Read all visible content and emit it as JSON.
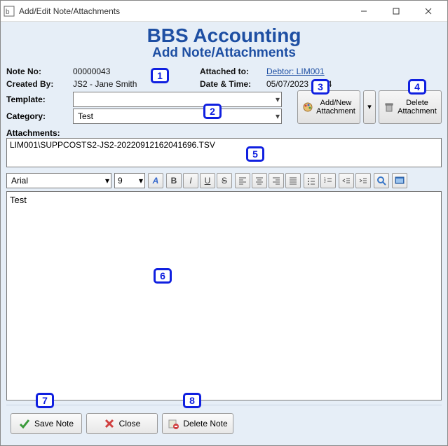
{
  "window": {
    "title": "Add/Edit Note/Attachments"
  },
  "heading": {
    "app": "BBS Accounting",
    "page": "Add Note/Attachments"
  },
  "info": {
    "note_no_label": "Note No:",
    "note_no": "00000043",
    "attached_to_label": "Attached to:",
    "attached_to": "Debtor: LIM001",
    "created_by_label": "Created By:",
    "created_by": "JS2 - Jane Smith",
    "datetime_label": "Date & Time:",
    "datetime": "05/07/2023 12:14"
  },
  "controls": {
    "template_label": "Template:",
    "template_value": "",
    "category_label": "Category:",
    "category_value": "Test",
    "attachments_label": "Attachments:",
    "attachments_value": "LIM001\\SUPPCOSTS2-JS2-20220912162041696.TSV",
    "add_attachment": "Add/New\nAttachment",
    "delete_attachment": "Delete\nAttachment"
  },
  "editor": {
    "font": "Arial",
    "size": "9",
    "text": "Test"
  },
  "footer": {
    "save": "Save Note",
    "close": "Close",
    "delete": "Delete Note"
  },
  "badges": [
    "1",
    "2",
    "3",
    "4",
    "5",
    "6",
    "7",
    "8"
  ]
}
